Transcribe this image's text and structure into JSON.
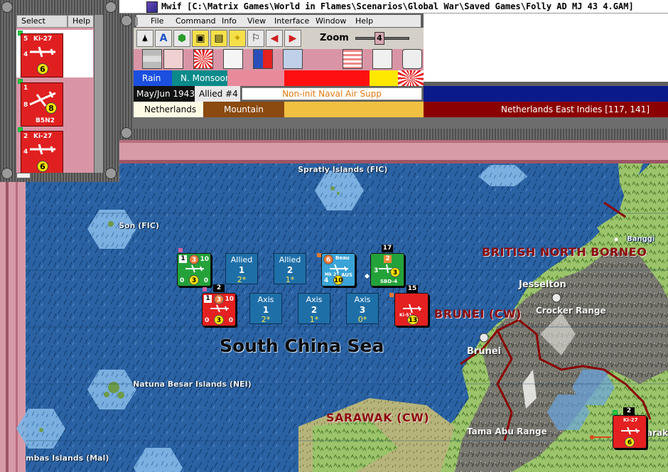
{
  "window": {
    "title": "Mwif [C:\\Matrix Games\\World in Flames\\Scenarios\\Global War\\Saved Games\\Folly AD MJ 43 4.GAM]"
  },
  "left_panel": {
    "tabs": [
      "Select",
      "Help"
    ],
    "units": [
      {
        "name": "Ki-27",
        "value": "6",
        "top": "5",
        "side": "4"
      },
      {
        "name": "B5N2",
        "value": "8",
        "top": "1",
        "side": "8"
      },
      {
        "name": "Ki-27",
        "value": "6",
        "top": "2",
        "side": "4"
      }
    ]
  },
  "menu": [
    "File",
    "Command",
    "Info",
    "View",
    "Interface",
    "Window",
    "Help"
  ],
  "toolbar": {
    "buttons": [
      "unit-icon",
      "text-icon",
      "hex-icon",
      "stack-icon",
      "flame-icon",
      "flag-icon",
      "arrow-left-icon",
      "arrow-right-icon"
    ],
    "zoom_label": "Zoom",
    "zoom_value": "4"
  },
  "status": {
    "weather": "Rain",
    "weather_zone": "N. Monsoon",
    "date": "May/Jun 1943",
    "impulse": "Allied #4",
    "phase": "Non-init Naval Air Supp",
    "controller": "Netherlands",
    "terrain": "Mountain",
    "location": "Netherlands East Indies [117, 141]"
  },
  "colors": {
    "rain": "#1b4fe0",
    "monsoon": "#0b8a8a",
    "netherlands_bg": "#fffce6",
    "mountain": "#8a4a10",
    "location_bg": "#8b0000",
    "japan_red": "#e52020",
    "allied_box": "#1e6fa8",
    "usa_green": "#24a23a"
  },
  "map": {
    "sea_name": "South China Sea",
    "regions": [
      "BRITISH NORTH BORNEO",
      "BRUNEI (CW)",
      "SARAWAK (CW)"
    ],
    "islands": [
      "Spratly Islands (FIC)",
      "Son (FIC)",
      "Natuna Besar Islands (NEI)",
      "mbas Islands (Mal)"
    ],
    "places": [
      "Banggi",
      "Jesselton",
      "Crocker Range",
      "Brunei",
      "Tama Abu Range",
      "arak"
    ]
  },
  "boxes": [
    {
      "side": "Allied",
      "num": "1",
      "val": "2*"
    },
    {
      "side": "Allied",
      "num": "2",
      "val": "1*"
    },
    {
      "side": "Axis",
      "num": "1",
      "val": "2*"
    },
    {
      "side": "Axis",
      "num": "2",
      "val": "1*"
    },
    {
      "side": "Axis",
      "num": "3",
      "val": "0*"
    }
  ],
  "counters": {
    "green1": {
      "a": "1",
      "b": "3",
      "c": "10",
      "d": "0",
      "e": "3",
      "f": "0"
    },
    "beau": {
      "name": "Beau",
      "sub": "AUS",
      "a": "6",
      "b": "4",
      "c": "10",
      "d": "Mk 21"
    },
    "sbd": {
      "stack": "17",
      "a": "3",
      "b": "3",
      "c": "2",
      "name": "SBD-4"
    },
    "red1": {
      "stack": "2",
      "a": "1",
      "b": "3",
      "c": "10",
      "d": "0",
      "e": "3",
      "f": "0"
    },
    "red2": {
      "stack": "15",
      "a": "13",
      "name": "Ki-51"
    },
    "red3": {
      "stack": "2",
      "name": "Ki-27",
      "val": "6"
    }
  }
}
